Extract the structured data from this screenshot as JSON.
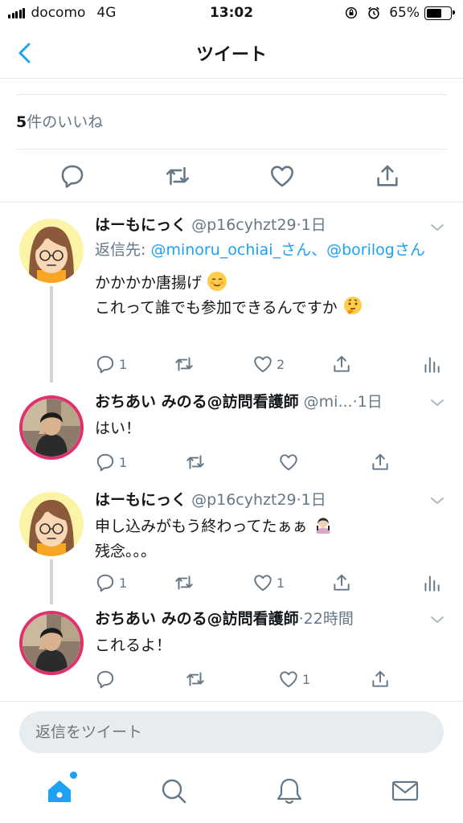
{
  "status_bar": {
    "carrier": "docomo",
    "network": "4G",
    "time": "13:02",
    "battery": "65%",
    "battery_level": 0.65,
    "icons": [
      "signal-icon",
      "orientation-lock-icon",
      "alarm-icon",
      "battery-icon"
    ]
  },
  "header": {
    "title": "ツイート",
    "back_icon": "chevron-left-icon"
  },
  "main_tweet": {
    "likes_count": "5",
    "likes_label": "件のいいね",
    "actions": [
      "reply-icon",
      "retweet-icon",
      "like-icon",
      "share-icon"
    ]
  },
  "replies": [
    {
      "name": "はーもにっく",
      "handle": "@p16cyhzt29",
      "time": "·1日",
      "reply_to_label": "返信先: ",
      "reply_to_1": "@minoru_ochiai_さん",
      "reply_to_sep": "、",
      "reply_to_2": "@borilogさん",
      "line1": "かかかか唐揚げ",
      "line2": "これって誰でも参加できるんですか",
      "reply_count": "1",
      "like_count": "2"
    },
    {
      "name": "おちあい みのる@訪問看護師",
      "handle": "@mi...",
      "time": "·1日",
      "line1": "はい！",
      "reply_count": "1",
      "like_count": ""
    },
    {
      "name": "はーもにっく",
      "handle": "@p16cyhzt29",
      "time": "·1日",
      "line1": "申し込みがもう終わってたぁぁ",
      "line2": "残念。。。",
      "reply_count": "1",
      "like_count": "1"
    },
    {
      "name": "おちあい みのる@訪問看護師",
      "handle": "",
      "time": "·22時間",
      "line1": "これるよ！",
      "reply_count": "",
      "like_count": "1"
    }
  ],
  "compose": {
    "placeholder": "返信をツイート"
  },
  "tabbar": {
    "items": [
      "home-icon",
      "search-icon",
      "notifications-icon",
      "messages-icon"
    ]
  },
  "colors": {
    "accent": "#1da1f2",
    "secondary_text": "#657786",
    "divider": "#e1e8ed"
  }
}
